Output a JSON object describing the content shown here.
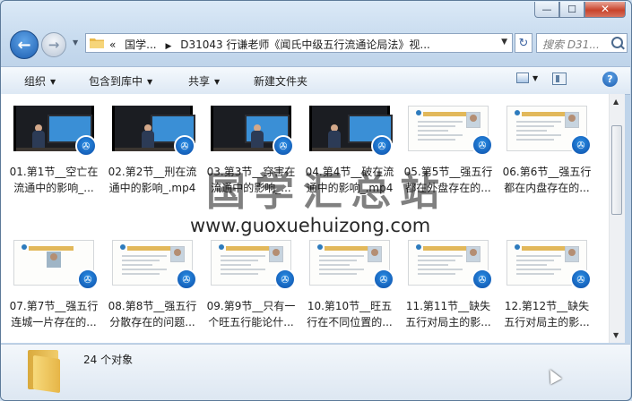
{
  "window": {
    "caption_buttons": {
      "minimize": "—",
      "maximize": "☐",
      "close": "✕"
    }
  },
  "address": {
    "crumbs": [
      "国学...",
      "D31043 行谦老师《闻氏中级五行流通论局法》视..."
    ],
    "prefix": "«"
  },
  "search": {
    "placeholder": "搜索 D31..."
  },
  "toolbar": {
    "organize": "组织",
    "include_in_library": "包含到库中",
    "share": "共享",
    "new_folder": "新建文件夹"
  },
  "files": [
    {
      "line1": "01.第1节__空亡在",
      "line2": "流通中的影响_...",
      "thumb": "video"
    },
    {
      "line1": "02.第2节__刑在流",
      "line2": "通中的影响_.mp4",
      "thumb": "video"
    },
    {
      "line1": "03.第3节__穿害在",
      "line2": "流通中的影响_...",
      "thumb": "video"
    },
    {
      "line1": "04.第4节__破在流",
      "line2": "通中的影响_.mp4",
      "thumb": "video"
    },
    {
      "line1": "05.第5节__强五行",
      "line2": "都在外盘存在的...",
      "thumb": "slide"
    },
    {
      "line1": "06.第6节__强五行",
      "line2": "都在内盘存在的...",
      "thumb": "slide"
    },
    {
      "line1": "07.第7节__强五行",
      "line2": "连城一片存在的...",
      "thumb": "slide-face"
    },
    {
      "line1": "08.第8节__强五行",
      "line2": "分散存在的问题...",
      "thumb": "slide"
    },
    {
      "line1": "09.第9节__只有一",
      "line2": "个旺五行能论什...",
      "thumb": "slide"
    },
    {
      "line1": "10.第10节__旺五",
      "line2": "行在不同位置的...",
      "thumb": "slide"
    },
    {
      "line1": "11.第11节__缺失",
      "line2": "五行对局主的影...",
      "thumb": "slide"
    },
    {
      "line1": "12.第12节__缺失",
      "line2": "五行对局主的影...",
      "thumb": "slide"
    }
  ],
  "watermark": {
    "title": "国学汇总站",
    "url": "www.guoxuehuizong.com"
  },
  "details": {
    "count": "24 个对象"
  },
  "icons": [
    "back-arrow-icon",
    "forward-arrow-icon",
    "folder-icon",
    "refresh-icon",
    "search-icon",
    "view-icon",
    "layout-icon",
    "help-icon",
    "video-badge-icon",
    "mouse-cursor-icon"
  ]
}
